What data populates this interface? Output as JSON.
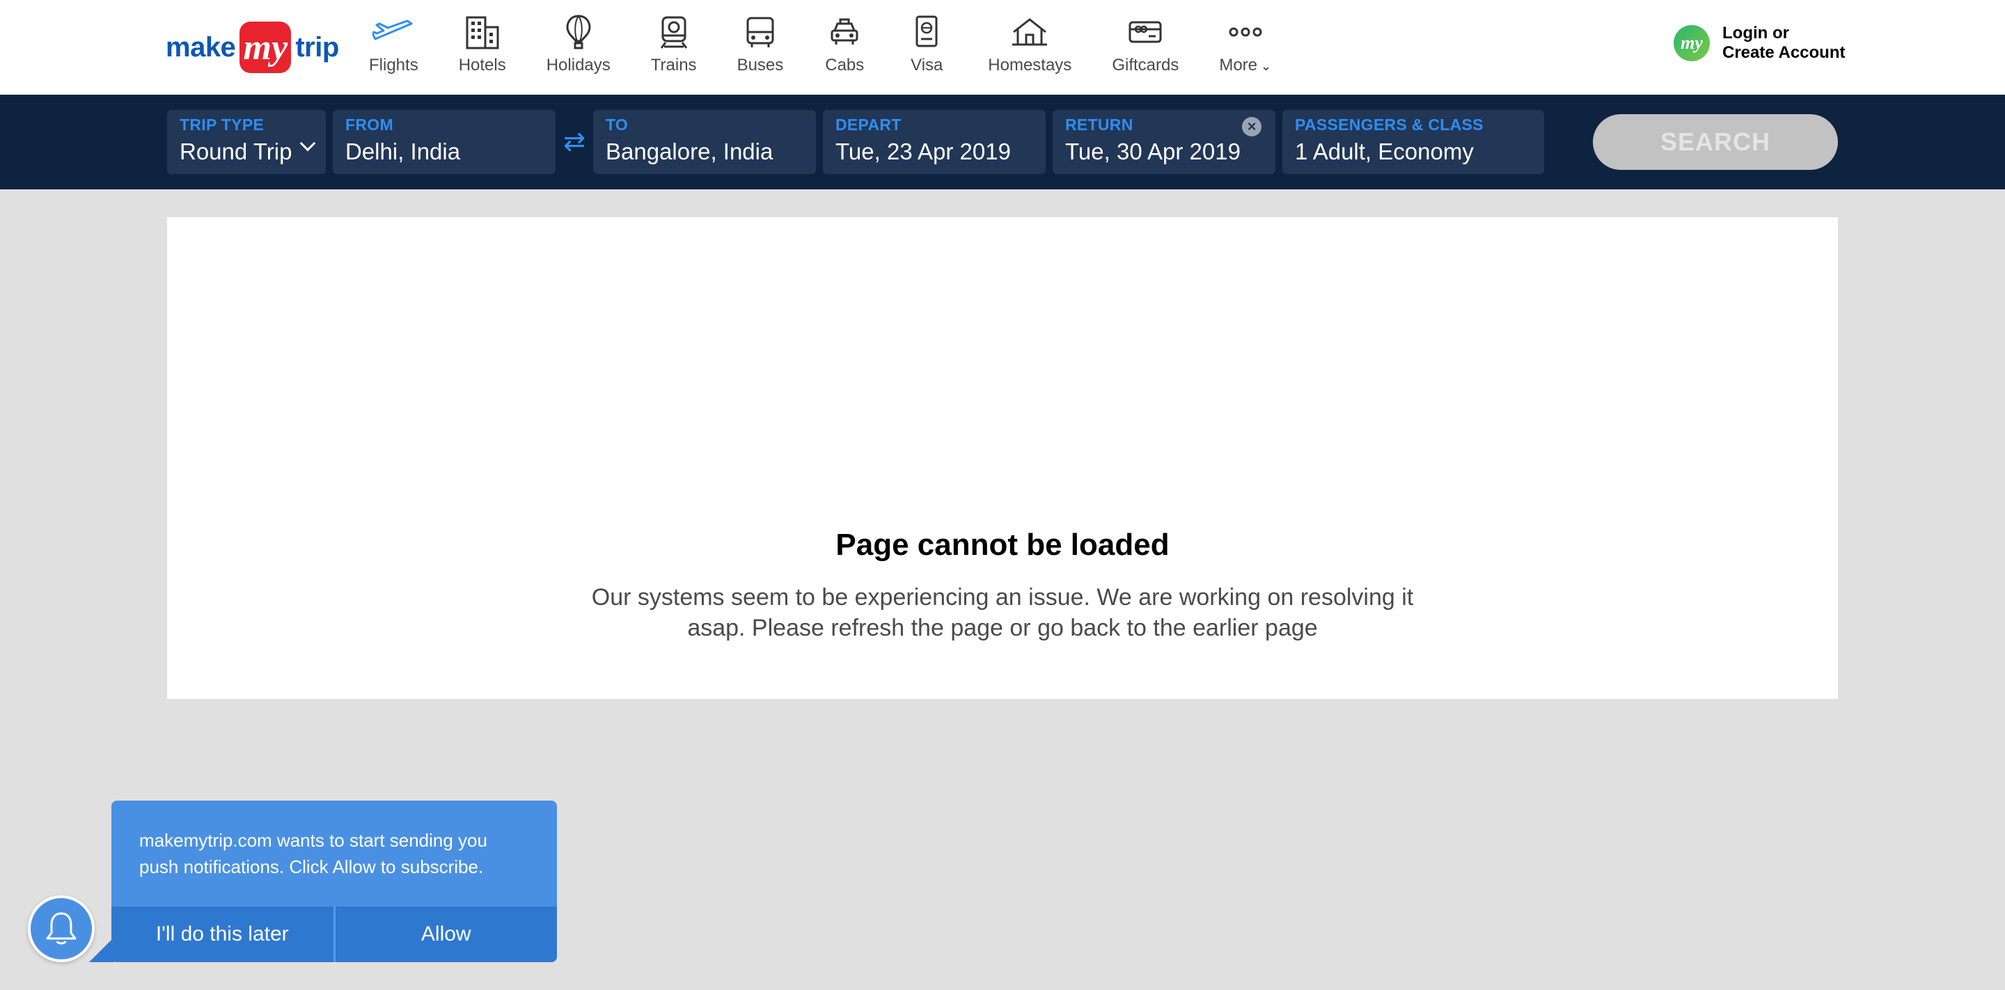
{
  "brand": {
    "make": "make",
    "my": "my",
    "trip": "trip"
  },
  "nav": {
    "items": [
      {
        "label": "Flights",
        "icon": "plane-icon"
      },
      {
        "label": "Hotels",
        "icon": "building-icon"
      },
      {
        "label": "Holidays",
        "icon": "hot-air-balloon-icon"
      },
      {
        "label": "Trains",
        "icon": "train-icon"
      },
      {
        "label": "Buses",
        "icon": "bus-icon"
      },
      {
        "label": "Cabs",
        "icon": "cab-icon"
      },
      {
        "label": "Visa",
        "icon": "passport-icon"
      },
      {
        "label": "Homestays",
        "icon": "house-icon"
      },
      {
        "label": "Giftcards",
        "icon": "giftcard-icon"
      },
      {
        "label": "More",
        "icon": "more-dots-icon"
      }
    ],
    "active_color": "#2f8ef0"
  },
  "account": {
    "avatar": "my",
    "line1": "Login or",
    "line2": "Create Account"
  },
  "search": {
    "trip_type": {
      "label": "TRIP TYPE",
      "value": "Round Trip"
    },
    "from": {
      "label": "FROM",
      "value": "Delhi, India"
    },
    "to": {
      "label": "TO",
      "value": "Bangalore, India"
    },
    "depart": {
      "label": "DEPART",
      "value": "Tue, 23 Apr 2019"
    },
    "return": {
      "label": "RETURN",
      "value": "Tue, 30 Apr 2019"
    },
    "passengers": {
      "label": "PASSENGERS & CLASS",
      "value": "1 Adult, Economy"
    },
    "swap_glyph": "⇄",
    "clear_glyph": "×",
    "button": "SEARCH"
  },
  "error": {
    "title": "Page cannot be loaded",
    "message": "Our systems seem to be experiencing an issue. We are working on resolving it asap. Please refresh the page or go back to the earlier page"
  },
  "push": {
    "message": "makemytrip.com wants to start sending you push notifications. Click Allow to subscribe.",
    "later": "I'll do this later",
    "allow": "Allow"
  },
  "colors": {
    "header_bg": "#ffffff",
    "search_band": "#0d2340",
    "field_bg": "#223656",
    "label_blue": "#2f8ef0",
    "push_blue": "#4a90e2",
    "brand_red": "#e7242e",
    "brand_blue": "#0a58b5"
  }
}
